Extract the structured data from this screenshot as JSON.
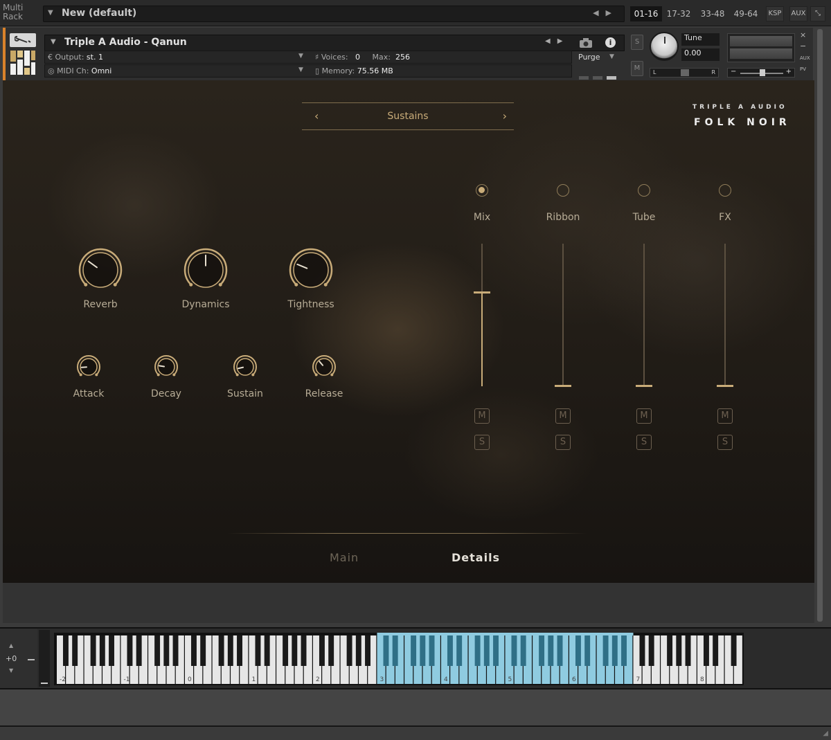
{
  "rack": {
    "multi_rack_label": "Multi\nRack",
    "multi_name": "New (default)",
    "pages": [
      "01-16",
      "17-32",
      "33-48",
      "49-64"
    ],
    "active_page": "01-16",
    "ksp_label": "KSP",
    "aux_label": "AUX"
  },
  "instrument": {
    "name": "Triple A Audio - Qanun",
    "output_label": "Output:",
    "output_value": "st. 1",
    "midi_label": "MIDI Ch:",
    "midi_value": "Omni",
    "voices_label": "Voices:",
    "voices_value": "0",
    "max_label": "Max:",
    "max_value": "256",
    "memory_label": "Memory:",
    "memory_value": "75.56 MB",
    "purge_label": "Purge",
    "solo_label": "S",
    "mute_label": "M",
    "tune_label": "Tune",
    "tune_value": "0.00",
    "pan_left": "L",
    "pan_right": "R",
    "vol_minus": "−",
    "vol_plus": "+",
    "aux_side": "AUX",
    "pv_side": "PV",
    "close_glyph": "×",
    "min_glyph": "−"
  },
  "panel": {
    "preset_name": "Sustains",
    "brand_small": "TRIPLE A AUDIO",
    "brand_big": "FOLK NOIR",
    "big_knobs": [
      {
        "label": "Reverb",
        "value": 0.3
      },
      {
        "label": "Dynamics",
        "value": 0.5
      },
      {
        "label": "Tightness",
        "value": 0.25
      }
    ],
    "small_knobs": [
      {
        "label": "Attack",
        "value": 0.15
      },
      {
        "label": "Decay",
        "value": 0.2
      },
      {
        "label": "Sustain",
        "value": 0.12
      },
      {
        "label": "Release",
        "value": 0.35
      }
    ],
    "mics": [
      {
        "label": "Mix",
        "selected": true,
        "level": 0.66,
        "mute": "M",
        "solo": "S"
      },
      {
        "label": "Ribbon",
        "selected": false,
        "level": 0.0,
        "mute": "M",
        "solo": "S"
      },
      {
        "label": "Tube",
        "selected": false,
        "level": 0.0,
        "mute": "M",
        "solo": "S"
      },
      {
        "label": "FX",
        "selected": false,
        "level": 0.0,
        "mute": "M",
        "solo": "S"
      }
    ],
    "tabs": [
      {
        "label": "Main",
        "active": false
      },
      {
        "label": "Details",
        "active": true
      }
    ],
    "colors": {
      "accent": "#c9ac79",
      "dim": "#6d6050",
      "keyswitch": "#8fcbe0"
    }
  },
  "keyboard": {
    "octave_shift": "+0",
    "octave_labels": [
      "-2",
      "-1",
      "0",
      "1",
      "2",
      "3",
      "4",
      "5",
      "6",
      "7",
      "8"
    ],
    "highlight_octaves": [
      "3",
      "4",
      "5",
      "6"
    ]
  }
}
